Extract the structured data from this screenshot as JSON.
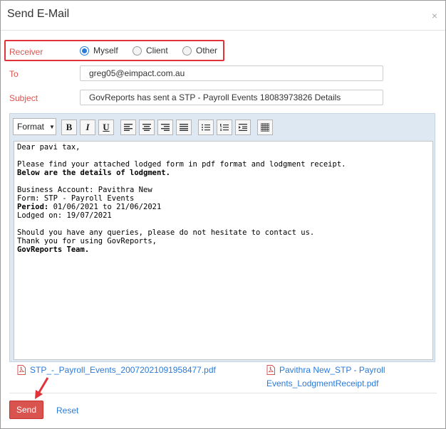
{
  "dialog": {
    "title": "Send E-Mail",
    "close_glyph": "×"
  },
  "receiver": {
    "label": "Receiver",
    "options": [
      "Myself",
      "Client",
      "Other"
    ],
    "selected": "Myself"
  },
  "to": {
    "label": "To",
    "value": "greg05@eimpact.com.au"
  },
  "subject": {
    "label": "Subject",
    "value": "GovReports has sent a STP - Payroll Events 18083973826 Details"
  },
  "toolbar": {
    "format_label": "Format",
    "bold": "B",
    "italic": "I",
    "underline": "U",
    "icons": [
      "align-left-icon",
      "align-center-icon",
      "align-right-icon",
      "align-justify-icon",
      "bullet-list-icon",
      "numbered-list-icon",
      "indent-icon",
      "table-icon"
    ]
  },
  "body": {
    "greeting": "Dear pavi tax,",
    "intro": "Please find your attached lodged form in pdf format and lodgment receipt.",
    "details_heading": "Below are the details of lodgment.",
    "business_account": "Business Account: Pavithra New",
    "form": "Form: STP - Payroll Events",
    "period_label": "Period:",
    "period_value": " 01/06/2021 to 21/06/2021",
    "lodged_on": "Lodged on: 19/07/2021",
    "queries": "Should you have any queries, please do not hesitate to contact us.",
    "thanks": "Thank you for using GovReports,",
    "signature": "GovReports Team."
  },
  "attachments": {
    "file1": "STP_-_Payroll_Events_20072021091958477.pdf",
    "file2_line1": "Pavithra New_STP - Payroll",
    "file2_line2": "Events_LodgmentReceipt.pdf"
  },
  "actions": {
    "send": "Send",
    "reset": "Reset"
  },
  "colors": {
    "accent_red": "#d9534f",
    "highlight_border": "#e0343a",
    "link_blue": "#2a7ad9",
    "editor_bg": "#dde8f3"
  }
}
